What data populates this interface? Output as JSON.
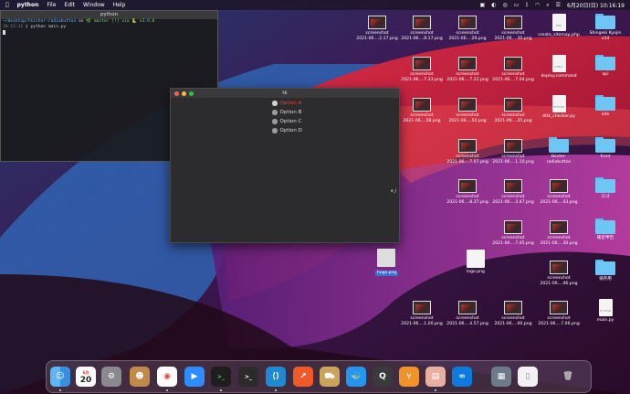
{
  "menubar": {
    "app": "python",
    "items": [
      "File",
      "Edit",
      "Window",
      "Help"
    ],
    "clock": "6月20日(日)  10:16:19"
  },
  "terminal": {
    "title": "python",
    "prompt_path": "~/desktop/tkinter-radiobutton",
    "prompt_on": "on",
    "prompt_branch": "🌿 master [!] via 🐍 v3.9.6",
    "timestamp": "10:15:11",
    "command": "❯ python main.py"
  },
  "tk": {
    "title": "tk",
    "options": [
      "Option A",
      "Option B",
      "Option C",
      "Option D"
    ],
    "selected_index": 0
  },
  "desktop": {
    "screenshots": [
      {
        "label1": "screenshot",
        "label2": "2021-06....2.17.png"
      },
      {
        "label1": "screenshot",
        "label2": "2021-06....8.17.png"
      },
      {
        "label1": "screenshot",
        "label2": "2021-06....29.png"
      },
      {
        "label1": "screenshot",
        "label2": "2021-06....30.png"
      },
      {
        "label1": "screenshot",
        "label2": "2021-06....7.33.png"
      },
      {
        "label1": "screenshot",
        "label2": "2021-06....7.22.png"
      },
      {
        "label1": "screenshot",
        "label2": "2021-06....7.04.png"
      },
      {
        "label1": "screenshot",
        "label2": "2021-06....58.png"
      },
      {
        "label1": "screenshot",
        "label2": "2021-06....54.png"
      },
      {
        "label1": "screenshot",
        "label2": "2021-06....35.png"
      },
      {
        "label1": "screenshot",
        "label2": "2021-06....7.07.png"
      },
      {
        "label1": "screenshot",
        "label2": "2021-06....1.10.png"
      },
      {
        "label1": "screenshot",
        "label2": "2021-06....8.37.png"
      },
      {
        "label1": "screenshot",
        "label2": "2021-06....3.47.png"
      },
      {
        "label1": "screenshot",
        "label2": "2021-06....43.png"
      },
      {
        "label1": "screenshot",
        "label2": "2021-06....7.45.png"
      },
      {
        "label1": "screenshot",
        "label2": "2021-06....30.png"
      },
      {
        "label1": "screenshot",
        "label2": "2021-06....46.png"
      },
      {
        "label1": "screenshot",
        "label2": "2021-06....1.00.png"
      },
      {
        "label1": "screenshot",
        "label2": "2021-06....4.57.png"
      },
      {
        "label1": "screenshot",
        "label2": "2021-06....00.png"
      },
      {
        "label1": "screenshot",
        "label2": "2021-06....7.06.png"
      }
    ],
    "files": {
      "sitemap": "create_sitemap.php",
      "deploy": "deploy.command",
      "checker": "404_checker.py",
      "logo": "logo.png",
      "hoge": "hoge.png",
      "main": "main.py",
      "tkinter_folder_1": "tkinter-",
      "tkinter_folder_2": "radiobutton"
    },
    "folders": {
      "shingeki_1": "Shingeki Kyojin",
      "shingeki_2": "v34",
      "api": "api",
      "site": "site",
      "front": "front",
      "logo_jp": "ロゴ",
      "kakutei": "確定申告",
      "hozon": "保存用"
    },
    "partial_label": "e_l"
  },
  "dock": {
    "apps": [
      "Finder",
      "Calendar",
      "System Preferences",
      "Contacts",
      "Chrome",
      "Zoom",
      "Terminal",
      "Terminal 2",
      "VS Code",
      "Activity",
      "Transmit",
      "Docker",
      "QuickTime",
      "Sourcetree",
      "Preview",
      "Infinity",
      "Screenshot",
      "Document",
      "Trash"
    ],
    "calendar_month": "6月",
    "calendar_day": "20"
  }
}
